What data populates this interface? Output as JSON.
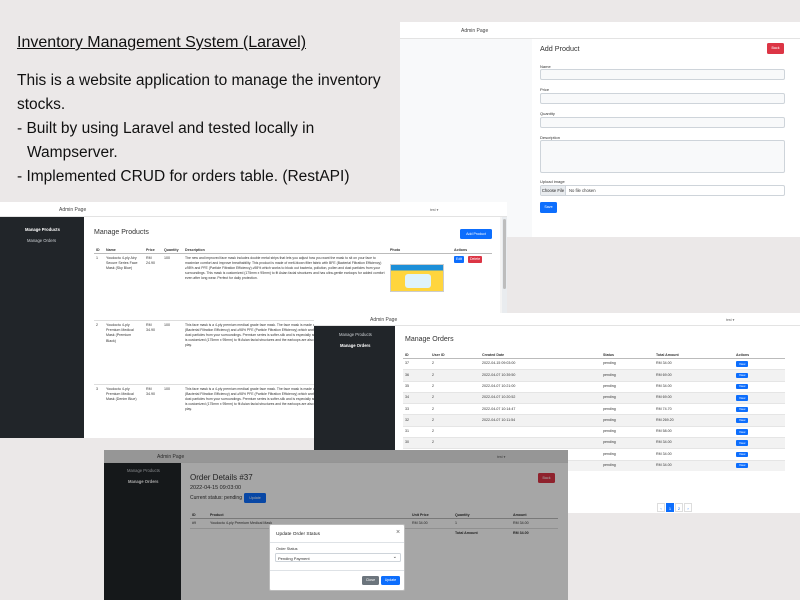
{
  "intro": {
    "title": "Inventory Management System (Laravel)",
    "description": "This is a website application to manage the inventory stocks.",
    "points": [
      "- Built by using Laravel and tested locally in Wampserver.",
      "- Implemented CRUD for orders table. (RestAPI)"
    ]
  },
  "admin_title": "Admin Page",
  "user_menu": "test ▾",
  "sidebar": {
    "manage_products": "Manage Products",
    "manage_orders": "Manage Orders"
  },
  "add_product": {
    "title": "Add Product",
    "back_button": "Back",
    "fields": {
      "name": "Name",
      "price": "Price",
      "quantity": "Quantity",
      "description": "Description",
      "upload": "Upload image"
    },
    "choose_file": "Choose File",
    "no_file": "No file chosen",
    "save_button": "Save"
  },
  "products": {
    "title": "Manage Products",
    "add_button": "Add Product",
    "headers": [
      "ID",
      "Name",
      "Price",
      "Quantity",
      "Description",
      "Photo",
      "Actions"
    ],
    "edit_label": "Edit",
    "delete_label": "Delete",
    "rows": [
      {
        "id": "1",
        "name": "Youdoctu 4-ply Airy Secure Series Face Mask (Sky Blue)",
        "price": "RM 24.90",
        "qty": "100",
        "description": "The new and improved face mask includes double metal strips that lets you adjust how you want the mask to sit on your face to maximize comfort and improve breathability. This product is made of melt-blown filter fabric with BFE (Bacterial Filtration Efficiency) ≥98% and PFE (Particle Filtration Efficiency) ≥98% which works to block out bacteria, pollution, pollen and dust particles from your surroundings. This mask is customized (175mm x 95mm) to fit Asian facial structures and has ultra-gentle earloops for added comfort even after long wear. Perfect for daily protection."
      },
      {
        "id": "2",
        "name": "Youdoctu 4-ply Premium Medical Mask (Premium Black)",
        "price": "RM 34.90",
        "qty": "100",
        "description": "This face mask is a 4-ply premium medical grade face mask. The face mask is made of melt-blown filter fabric with ≥98% BFE (Bacterial Filtration Efficiency) and ≥98% PFE (Particle Filtration Efficiency) which works to block out bacteria, pollution, pollen and dust particles from your surroundings. Premium series is softer-silk and is especially suitable for those with sensitive skin. This mask is customized (175mm x 95mm) to fit Asian facial structures and the earloops are also ultra-gentle for protection for both work and play."
      },
      {
        "id": "3",
        "name": "Youdoctu 4-ply Premium Medical Mask (Denim Blue)",
        "price": "RM 34.90",
        "qty": "100",
        "description": "This face mask is a 4-ply premium medical grade face mask. The face mask is made of melt-blown filter fabric with ≥98% BFE (Bacterial Filtration Efficiency) and ≥98% PFE (Particle Filtration Efficiency) which works to block out bacteria, pollution, pollen and dust particles from your surroundings. Premium series is softer-silk and is especially suitable for those with sensitive skin. This mask is customized (175mm x 95mm) to fit Asian facial structures and the earloops are also ultra-gentle for protection for both work and play."
      }
    ]
  },
  "orders": {
    "title": "Manage Orders",
    "headers": [
      "ID",
      "User ID",
      "Created Date",
      "Status",
      "Total Amount",
      "Actions"
    ],
    "view_label": "View",
    "rows": [
      {
        "id": "37",
        "user": "2",
        "date": "2022-04-15 09:03:00",
        "status": "pending",
        "total": "RM 34.00"
      },
      {
        "id": "36",
        "user": "2",
        "date": "2022-04-07 10:39:50",
        "status": "pending",
        "total": "RM 69.00"
      },
      {
        "id": "35",
        "user": "2",
        "date": "2022-04-07 10:21:00",
        "status": "pending",
        "total": "RM 34.00"
      },
      {
        "id": "34",
        "user": "2",
        "date": "2022-04-07 10:20:52",
        "status": "pending",
        "total": "RM 69.00"
      },
      {
        "id": "33",
        "user": "2",
        "date": "2022-04-07 10:14:47",
        "status": "pending",
        "total": "RM 74.70"
      },
      {
        "id": "32",
        "user": "2",
        "date": "2022-04-07 10:11:54",
        "status": "pending",
        "total": "RM 269.20"
      },
      {
        "id": "31",
        "user": "2",
        "date": "",
        "status": "pending",
        "total": "RM 58.00"
      },
      {
        "id": "30",
        "user": "2",
        "date": "",
        "status": "pending",
        "total": "RM 34.00"
      },
      {
        "id": "29",
        "user": "2",
        "date": "",
        "status": "pending",
        "total": "RM 34.00"
      },
      {
        "id": "28",
        "user": "2",
        "date": "",
        "status": "pending",
        "total": "RM 34.00"
      }
    ],
    "pager": [
      "‹",
      "1",
      "2",
      "›"
    ]
  },
  "order_details": {
    "title": "Order Details #37",
    "date": "2022-04-15 09:03:00",
    "status_label": "Current status: pending",
    "update_button": "Update",
    "back_button": "Back",
    "headers": [
      "ID",
      "Product",
      "Unit Price",
      "Quantity",
      "Amount"
    ],
    "row": {
      "id": "#9",
      "product": "Youdoctu 4-ply Premium Medical Mask",
      "price": "RM 34.00",
      "qty": "1",
      "amount": "RM 34.00"
    },
    "total_label": "Total Amount",
    "total_value": "RM 34.00"
  },
  "modal": {
    "title": "Update Order Status",
    "close_x": "×",
    "field_label": "Order Status",
    "selected": "Pending Payment",
    "close_button": "Close",
    "update_button": "Update"
  }
}
